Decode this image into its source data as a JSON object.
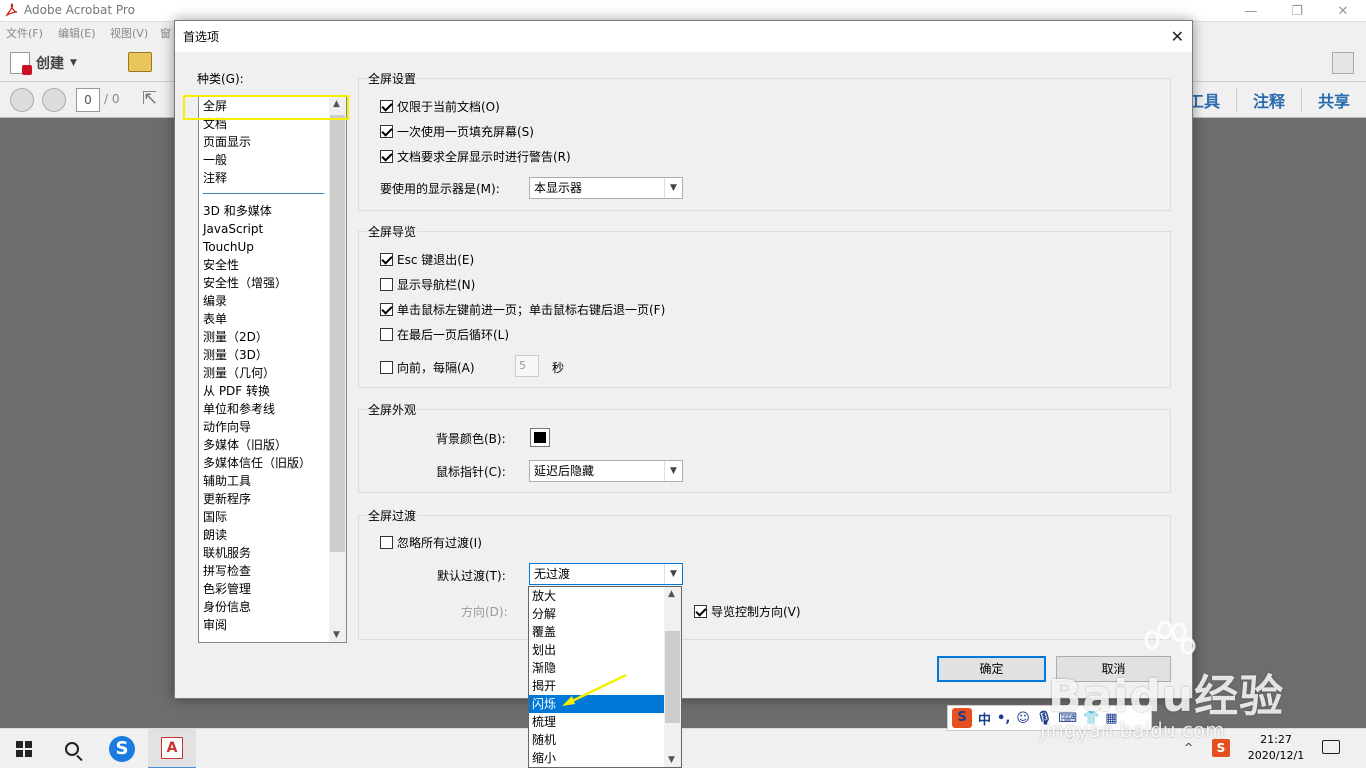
{
  "app": {
    "title": "Adobe Acrobat Pro",
    "menus": [
      "文件(F)",
      "编辑(E)",
      "视图(V)",
      "窗"
    ],
    "create_label": "创建",
    "page_current": "0",
    "page_total": "/ 0",
    "right_tabs": [
      "工具",
      "注释",
      "共享"
    ]
  },
  "dialog": {
    "title": "首选项",
    "category_label": "种类(G):",
    "categories_top": [
      "全屏",
      "文档",
      "页面显示",
      "一般",
      "注释"
    ],
    "categories": [
      "3D 和多媒体",
      "JavaScript",
      "TouchUp",
      "安全性",
      "安全性（增强）",
      "编录",
      "表单",
      "测量（2D）",
      "测量（3D）",
      "测量（几何）",
      "从 PDF 转换",
      "单位和参考线",
      "动作向导",
      "多媒体（旧版）",
      "多媒体信任（旧版）",
      "辅助工具",
      "更新程序",
      "国际",
      "朗读",
      "联机服务",
      "拼写检查",
      "色彩管理",
      "身份信息",
      "审阅"
    ],
    "setup": {
      "title": "全屏设置",
      "opt1": "仅限于当前文档(O)",
      "opt2": "一次使用一页填充屏幕(S)",
      "opt3": "文档要求全屏显示时进行警告(R)",
      "monitor_label": "要使用的显示器是(M):",
      "monitor_value": "本显示器"
    },
    "nav": {
      "title": "全屏导览",
      "opt1": "Esc 键退出(E)",
      "opt2": "显示导航栏(N)",
      "opt3": "单击鼠标左键前进一页；单击鼠标右键后退一页(F)",
      "opt4": "在最后一页后循环(L)",
      "opt5": "向前，每隔(A)",
      "interval_value": "5",
      "interval_unit": "秒"
    },
    "appearance": {
      "title": "全屏外观",
      "bg_label": "背景颜色(B):",
      "bg_color": "#000000",
      "cursor_label": "鼠标指针(C):",
      "cursor_value": "延迟后隐藏"
    },
    "transition": {
      "title": "全屏过渡",
      "ignore_label": "忽略所有过渡(I)",
      "default_label": "默认过渡(T):",
      "default_value": "无过渡",
      "direction_label": "方向(D):",
      "nav_direction_label": "导览控制方向(V)",
      "options": [
        "放大",
        "分解",
        "覆盖",
        "划出",
        "渐隐",
        "揭开",
        "闪烁",
        "梳理",
        "随机",
        "缩小"
      ],
      "selected": "闪烁"
    },
    "ok_label": "确定",
    "cancel_label": "取消"
  },
  "ime": {
    "logo": "S",
    "lang": "中",
    "punct": "•,"
  },
  "watermark": {
    "main": "Baidu经验",
    "url": "jingyan.baidu.com"
  },
  "taskbar": {
    "time": "21:27",
    "date": "2020/12/1",
    "sogou_glyph": "S",
    "acrobat_glyph": "A"
  }
}
